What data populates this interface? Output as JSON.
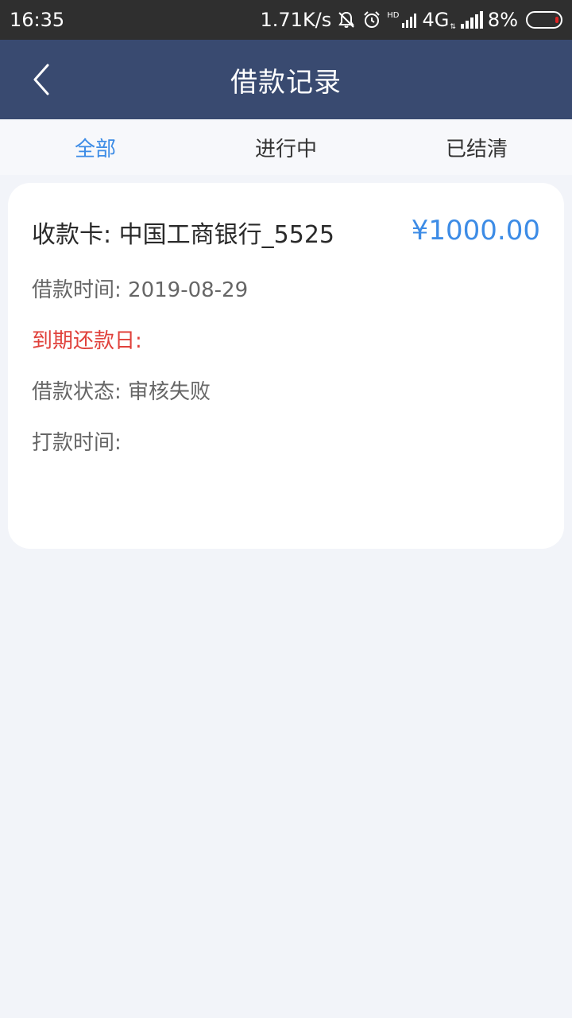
{
  "status_bar": {
    "time": "16:35",
    "speed": "1.71K/s",
    "hd": "HD",
    "network": "4G",
    "battery": "8%"
  },
  "header": {
    "title": "借款记录"
  },
  "tabs": [
    {
      "label": "全部",
      "active": true
    },
    {
      "label": "进行中",
      "active": false
    },
    {
      "label": "已结清",
      "active": false
    }
  ],
  "records": [
    {
      "card_label": "收款卡:",
      "card_value": "中国工商银行_5525",
      "amount": "¥1000.00",
      "loan_time_label": "借款时间:",
      "loan_time": "2019-08-29",
      "due_label": "到期还款日:",
      "due_value": "",
      "status_label": "借款状态:",
      "status": "审核失败",
      "payment_label": "打款时间:",
      "payment_value": ""
    }
  ],
  "colors": {
    "status_bar": "#2f2f2f",
    "nav_bar": "#394a70",
    "accent": "#3d8ce6",
    "danger": "#e0413b",
    "background": "#f2f4f9"
  }
}
